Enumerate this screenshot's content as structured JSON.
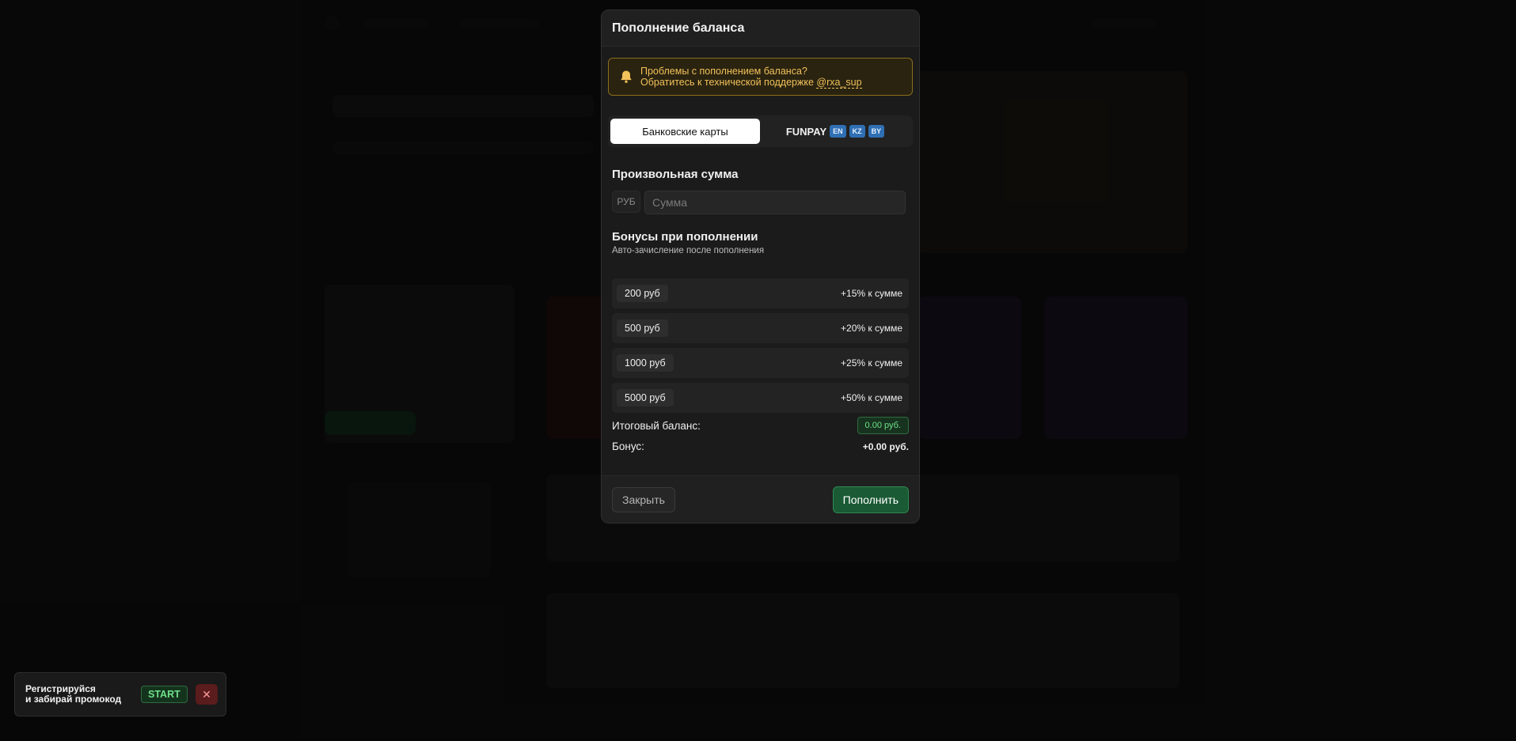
{
  "modal": {
    "title": "Пополнение баланса",
    "alert": {
      "line1": "Проблемы с пополнением баланса?",
      "line2_prefix": "Обратитесь к технической поддержке ",
      "link": "@rxa_sup",
      "icon": "bell-icon"
    },
    "tabs": {
      "active": "Банковские карты",
      "funpay_label": "FUNPAY",
      "funpay_tags": [
        "EN",
        "KZ",
        "BY"
      ]
    },
    "custom_amount": {
      "title": "Произвольная сумма",
      "currency": "РУБ",
      "placeholder": "Сумма",
      "value": ""
    },
    "bonuses": {
      "title": "Бонусы при пополнении",
      "subtitle": "Авто-зачисление после пополнения",
      "items": [
        {
          "amount": "200 руб",
          "bonus": "+15% к сумме"
        },
        {
          "amount": "500 руб",
          "bonus": "+20% к сумме"
        },
        {
          "amount": "1000 руб",
          "bonus": "+25% к сумме"
        },
        {
          "amount": "5000 руб",
          "bonus": "+50% к сумме"
        }
      ]
    },
    "summary": {
      "total_label": "Итоговый баланс:",
      "total_value": "0.00 руб.",
      "bonus_label": "Бонус:",
      "bonus_value": "+0.00 руб."
    },
    "footer": {
      "close_label": "Закрыть",
      "topup_label": "Пополнить"
    }
  },
  "toast": {
    "line1": "Регистрируйся",
    "line2": "и забирай промокод",
    "code": "START",
    "close_icon": "close-icon"
  },
  "colors": {
    "accent_green": "#6fe08a",
    "alert_yellow": "#f1c15a",
    "tag_blue": "#2f6fb3",
    "danger_red": "#5a1c1c"
  }
}
